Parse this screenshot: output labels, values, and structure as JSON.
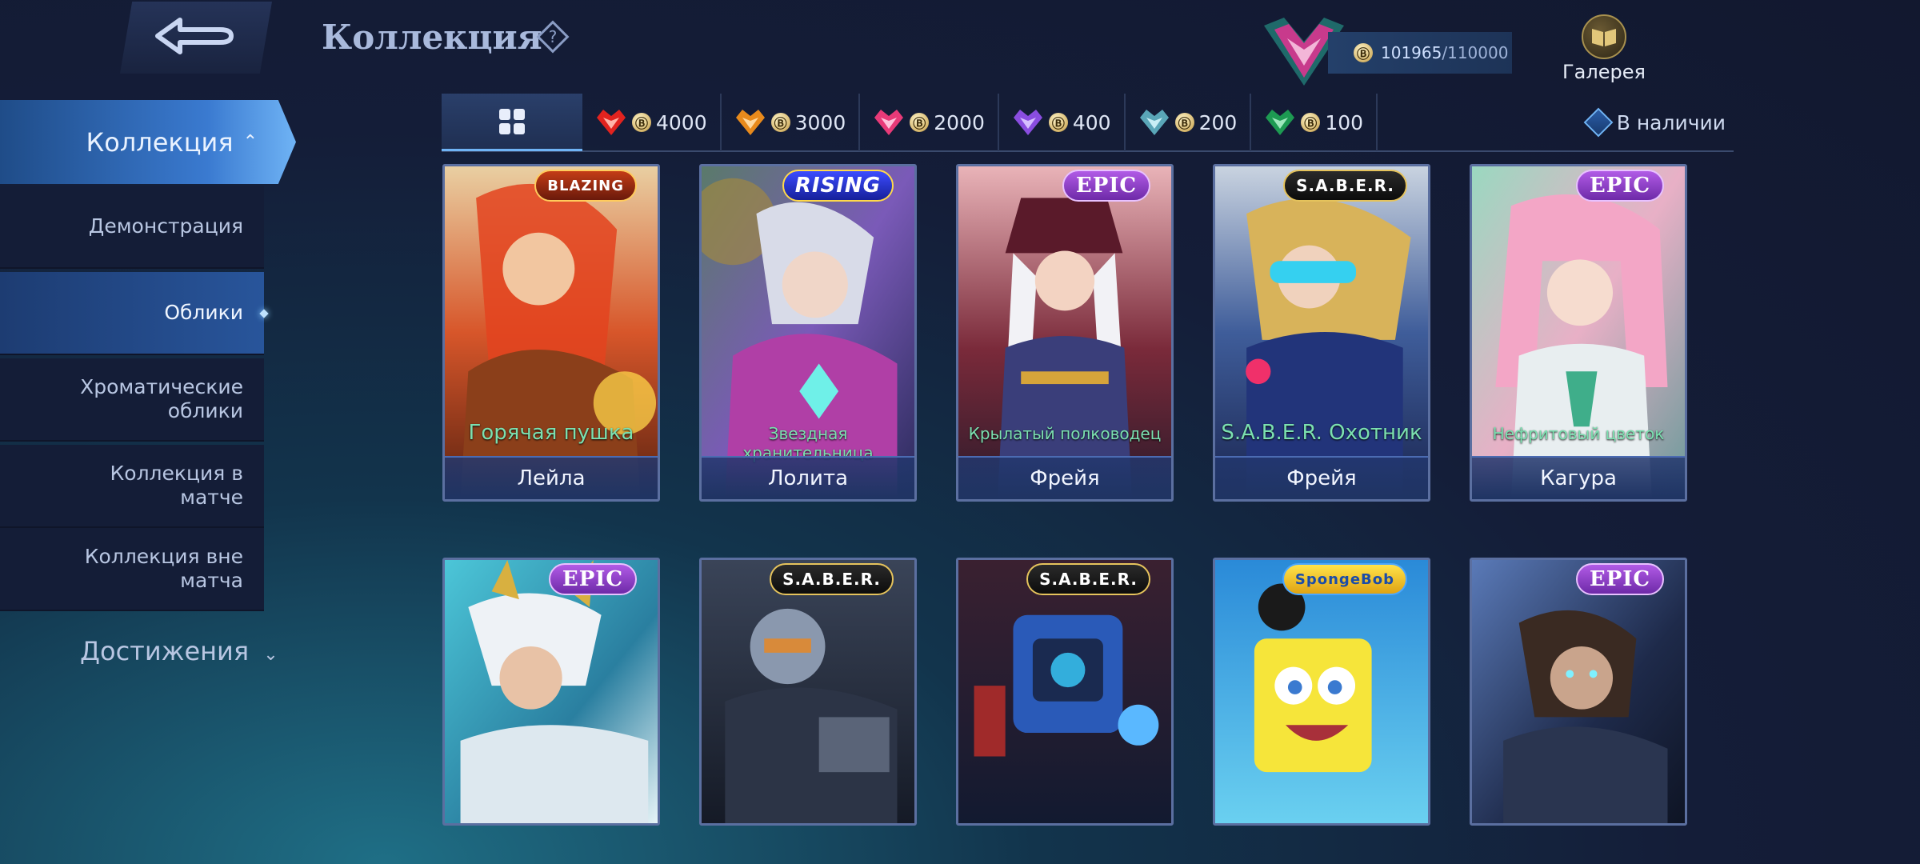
{
  "header": {
    "title": "Коллекция",
    "points_value": "101965",
    "points_max": "/110000",
    "gallery_label": "Галерея",
    "coin_glyph": "Ⓑ"
  },
  "sidebar": {
    "collection_label": "Коллекция",
    "items": [
      {
        "label": "Демонстрация"
      },
      {
        "label": "Облики"
      },
      {
        "label": "Хроматические облики"
      },
      {
        "label": "Коллекция в матче"
      },
      {
        "label": "Коллекция вне матча"
      }
    ],
    "achievements_label": "Достижения"
  },
  "filters": {
    "prices": [
      {
        "value": "4000",
        "color": "#e2231f"
      },
      {
        "value": "3000",
        "color": "#e88a1c"
      },
      {
        "value": "2000",
        "color": "#e83a78"
      },
      {
        "value": "400",
        "color": "#8a4de0"
      },
      {
        "value": "200",
        "color": "#5aa6b8"
      },
      {
        "value": "100",
        "color": "#1d9a52"
      }
    ],
    "in_stock_label": "В наличии"
  },
  "cards": [
    {
      "badge": "BLAZING",
      "skin": "Горячая пушка",
      "hero": "Лейла"
    },
    {
      "badge": "RISING",
      "skin": "Звездная хранительница",
      "hero": "Лолита"
    },
    {
      "badge": "EPIC",
      "skin": "Крылатый полководец",
      "hero": "Фрейя"
    },
    {
      "badge": "S.A.B.E.R.",
      "skin": "S.A.B.E.R. Охотник",
      "hero": "Фрейя"
    },
    {
      "badge": "EPIC",
      "skin": "Нефритовый цветок",
      "hero": "Кагура"
    },
    {
      "badge": "EPIC"
    },
    {
      "badge": "S.A.B.E.R."
    },
    {
      "badge": "S.A.B.E.R."
    },
    {
      "badge": "SpongeBob"
    },
    {
      "badge": "EPIC"
    }
  ],
  "colors": {
    "accent": "#3a7ad0",
    "epic": "#8a3cc8",
    "skin_name": "#7be0b0"
  }
}
